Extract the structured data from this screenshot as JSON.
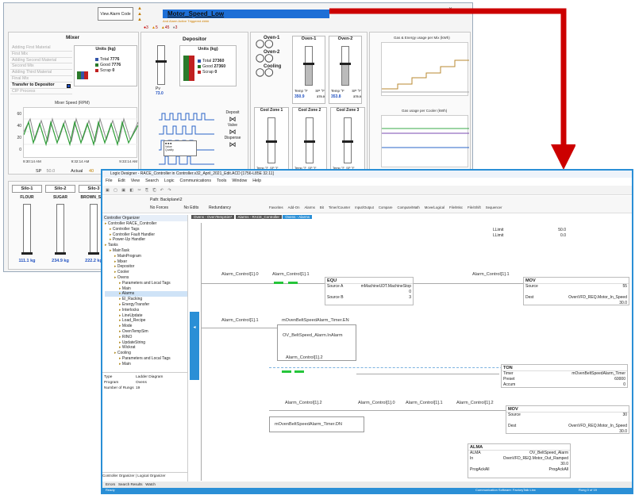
{
  "hmi": {
    "alarm_button": "View Alarm Code",
    "alarm_title": "Motor_Speed_Low",
    "alarm_subtitle": "And Alarm Active Triggered ####",
    "alarm_counts": [
      "3",
      "5",
      "45",
      "3"
    ],
    "mixer": {
      "title": "Mixer",
      "steps": [
        "Adding First Material",
        "First Mix",
        "Adding Second Material",
        "Second Mix",
        "Adding Third Material",
        "Final Mix",
        "Transfer to Depositor",
        "CIP Process"
      ],
      "active_step": 6,
      "units_title": "Units (kg)",
      "total_label": "Total",
      "total_value": "7776",
      "good_label": "Good",
      "good_value": "7776",
      "scrap_label": "Scrap",
      "scrap_value": "0",
      "speed_chart_title": "Mixer Speed (RPM)",
      "y_ticks": [
        "60",
        "40",
        "20",
        "0"
      ],
      "x_ticks": [
        "9:30:14 AM",
        "9:32:14 AM",
        "9:33:14 AM"
      ],
      "sp_label": "SP",
      "sp_value": "50.0",
      "actual_label": "Actual",
      "actual_value": "40"
    },
    "depositor": {
      "title": "Depositor",
      "pv_label": "Pv",
      "pv_value": "73.0",
      "units_title": "Units (kg)",
      "total_label": "Total",
      "total_value": "27360",
      "good_label": "Good",
      "good_value": "27360",
      "scrap_label": "Scrap",
      "scrap_value": "0",
      "deposit_label": "Deposit",
      "valve_label": "Valve",
      "dispense_label": "Dispense"
    },
    "ovens": {
      "oven1_label": "Oven-1",
      "oven2_label": "Oven-2",
      "cooling_label": "Cooling",
      "col1_title": "Oven-1",
      "col2_title": "Oven-2",
      "temp_label": "Temp °F",
      "sp_label": "SP °F",
      "oven1_temp": "350.9",
      "oven1_sp": "375.0",
      "oven2_temp": "353.8",
      "oven2_sp": "375.0",
      "cool1_title": "Cool Zone 1",
      "cool2_title": "Cool Zone 2",
      "cool3_title": "Cool Zone 3"
    },
    "energy_chart_title": "Gas & Energy usage per Mix (kWh)",
    "cooler_chart_title": "Gas usage per Cooler (kWh)",
    "silos": [
      {
        "title": "Silo-1",
        "material": "FLOUR",
        "value": "111.1 kg"
      },
      {
        "title": "Silo-2",
        "material": "SUGAR",
        "value": "234.9 kg"
      },
      {
        "title": "Silo-3",
        "material": "BROWN_SGR",
        "value": "222.2 kg"
      }
    ]
  },
  "logix": {
    "title": "Logix Designer - RACE_Controller in Controller.v32_April_2021_Edit.ACD [1756-L85E 32.11]",
    "menu": [
      "File",
      "Edit",
      "View",
      "Search",
      "Logic",
      "Communications",
      "Tools",
      "Window",
      "Help"
    ],
    "path_label": "Path: Backplane\\2",
    "toolbar_labels": [
      "No Forces",
      "No Edits",
      "Redundancy"
    ],
    "instr_tabs": [
      "Favorites",
      "Add-On",
      "Alarms",
      "Bit",
      "Timer/Counter",
      "Input/Output",
      "Compare",
      "Compute/Math",
      "Move/Logical",
      "File/Misc",
      "File/Shift",
      "Sequencer"
    ],
    "organizer_title": "Controller Organizer",
    "tree": [
      "Controller RACE_Controller",
      "Controller Tags",
      "Controller Fault Handler",
      "Power-Up Handler",
      "Tasks",
      "MainTask",
      "MainProgram",
      "Mixer",
      "Depositor",
      "Cooler",
      "Ovens",
      "Parameters and Local Tags",
      "Main",
      "Alarms",
      "El_Racking",
      "EnergyTransfer",
      "Interlocks",
      "LineUpdate",
      "Load_Recipe",
      "Mode",
      "OvenTempSim",
      "RINO",
      "UpdateString",
      "Wickrat",
      "Cooling",
      "Parameters and Local Tags",
      "Main"
    ],
    "tree_selected": 13,
    "props": [
      [
        "Type",
        "Ladder Diagram"
      ],
      [
        "Program",
        "Ovens"
      ],
      [
        "Number of Rungs",
        "19"
      ]
    ],
    "doc_tabs": [
      "Ovens - OvenTempSim*",
      "Alarms - RACE_Controller",
      "Ovens - Alarms"
    ],
    "bottom_tabs": [
      "Controller Organizer",
      "Logical Organizer"
    ],
    "output_tabs": [
      "Errors",
      "Search Results",
      "Watch"
    ],
    "status_left": "Ready",
    "status_right": "Communication Software: FactoryTalk Linx",
    "status_rung": "Rung 0 of 19",
    "lims": [
      [
        "LLimit",
        "50.0"
      ],
      [
        "LLimit",
        "0.0"
      ]
    ],
    "rung1": {
      "c1": "Alarm_Control[1].0",
      "c2": "Alarm_Control[1].1",
      "c3": "Alarm_Control[1].1",
      "equ_title": "EQU",
      "equ_rows": [
        [
          "Source A",
          "mMachineUDT.MachineStop"
        ],
        [
          "",
          "0"
        ],
        [
          "Source B",
          "3"
        ]
      ],
      "mov_title": "MOV",
      "mov_rows": [
        [
          "Source",
          "55"
        ],
        [
          "",
          ""
        ],
        [
          "Dest",
          "OvenVFD_REQ.Motor_In_Speed"
        ],
        [
          "",
          "30.0"
        ]
      ]
    },
    "rung2": {
      "c1": "Alarm_Control[1].1",
      "c2": "mOvenBeltSpeedAlarm_Timer.EN",
      "branch_tag": "OV_BeltSpeed_Alarm.InAlarm",
      "branch_c": "Alarm_Control[1].2",
      "ton_title": "TON",
      "ton_rows": [
        [
          "Timer",
          "mOvenBeltSpeedAlarm_Timer"
        ],
        [
          "Preset",
          "60000"
        ],
        [
          "Accum",
          "0"
        ]
      ],
      "c3": "Alarm_Control[1].2",
      "c4": "Alarm_Control[1].0",
      "c5": "Alarm_Control[1].1",
      "c6": "Alarm_Control[1].2",
      "c7": "mOvenBeltSpeedAlarm_Timer.DN",
      "mov_title": "MOV",
      "mov_rows": [
        [
          "Source",
          "30"
        ],
        [
          "",
          ""
        ],
        [
          "Dest",
          "OvenVFD_REQ.Motor_In_Speed"
        ],
        [
          "",
          "30.0"
        ]
      ]
    },
    "alma": {
      "title": "ALMA",
      "rows": [
        [
          "ALMA",
          "OV_BeltSpeed_Alarm"
        ],
        [
          "In",
          "OvenVFD_REQ.Motor_Out_Ramped"
        ],
        [
          "",
          "30.0"
        ],
        [
          "ProgAckAll",
          "ProgAckAll"
        ],
        [
          "",
          "0"
        ]
      ]
    }
  },
  "colors": {
    "accent": "#2a8fd6",
    "arrow": "#cc0000",
    "alarm_bar": "#1e6fd6",
    "green": "#25c53a"
  }
}
